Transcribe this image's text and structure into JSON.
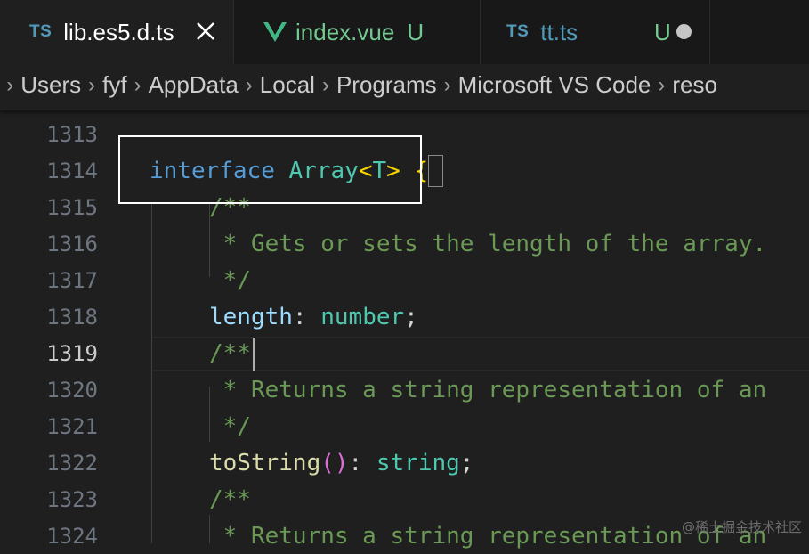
{
  "tabs": [
    {
      "icon": "TS",
      "label": "lib.es5.d.ts",
      "active": true
    },
    {
      "icon": "vue-logo",
      "label": "index.vue",
      "status": "U"
    },
    {
      "icon": "TS",
      "label": "tt.ts",
      "status": "U"
    }
  ],
  "breadcrumb": [
    "Users",
    "fyf",
    "AppData",
    "Local",
    "Programs",
    "Microsoft VS Code",
    "reso"
  ],
  "breadcrumb_lead": ":",
  "lines": [
    {
      "n": "1313"
    },
    {
      "n": "1314",
      "t": [
        "interface",
        " ",
        "Array",
        "<",
        "T",
        ">",
        " ",
        "{"
      ]
    },
    {
      "n": "1315",
      "t": [
        "/**"
      ]
    },
    {
      "n": "1316",
      "t": [
        " * Gets or sets the length of the array."
      ]
    },
    {
      "n": "1317",
      "t": [
        " */"
      ]
    },
    {
      "n": "1318",
      "t": [
        "length",
        ": ",
        "number",
        ";"
      ]
    },
    {
      "n": "1319",
      "t": [
        "/**"
      ]
    },
    {
      "n": "1320",
      "t": [
        " * Returns a string representation of an"
      ]
    },
    {
      "n": "1321",
      "t": [
        " */"
      ]
    },
    {
      "n": "1322",
      "t": [
        "toString",
        "()",
        ": ",
        "string",
        ";"
      ]
    },
    {
      "n": "1323",
      "t": [
        "/**"
      ]
    },
    {
      "n": "1324",
      "t": [
        " * Returns a string representation of an"
      ]
    }
  ],
  "watermark": "@稀土掘金技术社区",
  "colors": {
    "keyword": "#569cd6",
    "type": "#4ec9b0",
    "comment": "#6a9955",
    "property": "#9cdcfe",
    "bracket": "#ffd700"
  }
}
